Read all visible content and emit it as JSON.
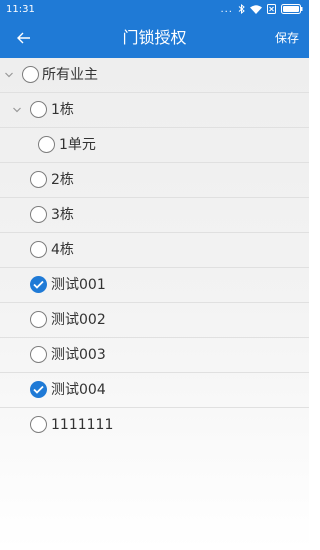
{
  "status_bar": {
    "time": "11:31",
    "dots": "..."
  },
  "app_bar": {
    "title": "门锁授权",
    "save_label": "保存"
  },
  "tree": [
    {
      "label": "所有业主",
      "checked": false,
      "expandable": true
    },
    {
      "label": "1栋",
      "checked": false,
      "expandable": true
    },
    {
      "label": "1单元",
      "checked": false,
      "expandable": false
    },
    {
      "label": "2栋",
      "checked": false,
      "expandable": false
    },
    {
      "label": "3栋",
      "checked": false,
      "expandable": false
    },
    {
      "label": "4栋",
      "checked": false,
      "expandable": false
    },
    {
      "label": "测试001",
      "checked": true,
      "expandable": false
    },
    {
      "label": "测试002",
      "checked": false,
      "expandable": false
    },
    {
      "label": "测试003",
      "checked": false,
      "expandable": false
    },
    {
      "label": "测试004",
      "checked": true,
      "expandable": false
    },
    {
      "label": "1111111",
      "checked": false,
      "expandable": false
    }
  ],
  "colors": {
    "accent": "#1f7ad6",
    "text": "#333333"
  }
}
